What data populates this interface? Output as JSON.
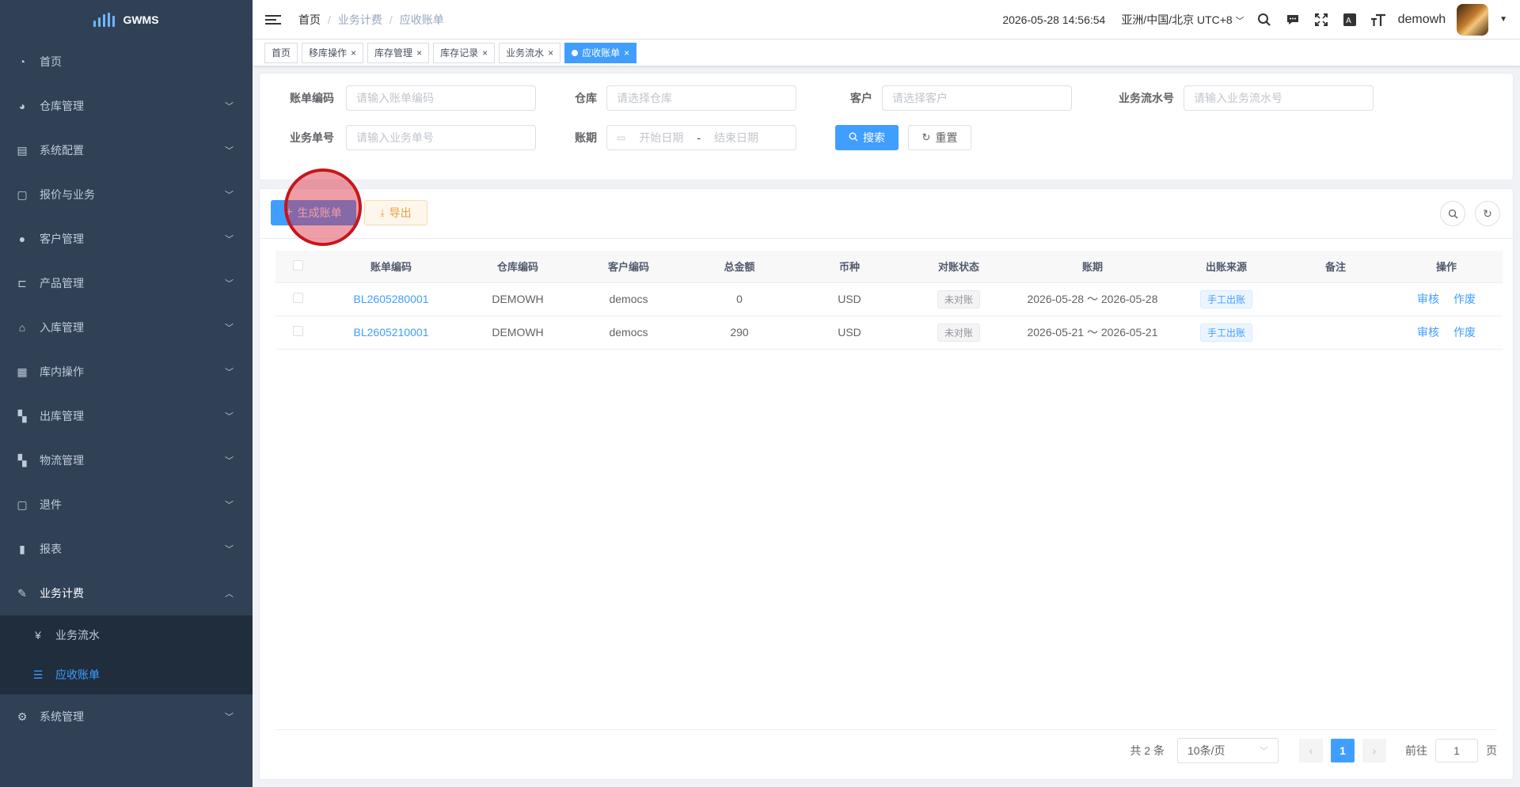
{
  "app": {
    "name": "GWMS"
  },
  "sidebar": {
    "items": [
      {
        "label": "首页",
        "icon": "dashboard-icon",
        "glyph": "◔"
      },
      {
        "label": "仓库管理",
        "icon": "globe-icon",
        "glyph": "◕"
      },
      {
        "label": "系统配置",
        "icon": "server-icon",
        "glyph": "▤"
      },
      {
        "label": "报价与业务",
        "icon": "document-icon",
        "glyph": "▢"
      },
      {
        "label": "客户管理",
        "icon": "user-icon",
        "glyph": "●"
      },
      {
        "label": "产品管理",
        "icon": "cart-icon",
        "glyph": "⊏"
      },
      {
        "label": "入库管理",
        "icon": "home-icon",
        "glyph": "⌂"
      },
      {
        "label": "库内操作",
        "icon": "table-icon",
        "glyph": "▦"
      },
      {
        "label": "出库管理",
        "icon": "grid-icon",
        "glyph": "▚"
      },
      {
        "label": "物流管理",
        "icon": "grid-icon",
        "glyph": "▚"
      },
      {
        "label": "退件",
        "icon": "document-icon",
        "glyph": "▢"
      },
      {
        "label": "报表",
        "icon": "bar-chart-icon",
        "glyph": "▮"
      },
      {
        "label": "业务计费",
        "icon": "edit-icon",
        "glyph": "✎"
      }
    ],
    "sub_items": [
      {
        "label": "业务流水",
        "icon": "yen-icon",
        "glyph": "¥"
      },
      {
        "label": "应收账单",
        "icon": "list-icon",
        "glyph": "☰"
      }
    ],
    "last_item": {
      "label": "系统管理",
      "icon": "gear-icon",
      "glyph": "⚙"
    }
  },
  "header": {
    "breadcrumb": [
      "首页",
      "业务计费",
      "应收账单"
    ],
    "datetime": "2026-05-28 14:56:54",
    "timezone": "亚洲/中国/北京 UTC+8",
    "username": "demowh"
  },
  "tags": [
    {
      "label": "首页",
      "closable": false
    },
    {
      "label": "移库操作",
      "closable": true
    },
    {
      "label": "库存管理",
      "closable": true
    },
    {
      "label": "库存记录",
      "closable": true
    },
    {
      "label": "业务流水",
      "closable": true
    },
    {
      "label": "应收账单",
      "closable": true,
      "active": true
    }
  ],
  "search": {
    "bill_code_label": "账单编码",
    "bill_code_placeholder": "请输入账单编码",
    "warehouse_label": "仓库",
    "warehouse_placeholder": "请选择仓库",
    "customer_label": "客户",
    "customer_placeholder": "请选择客户",
    "flow_label": "业务流水号",
    "flow_placeholder": "请输入业务流水号",
    "order_label": "业务单号",
    "order_placeholder": "请输入业务单号",
    "period_label": "账期",
    "start_placeholder": "开始日期",
    "range_sep": "-",
    "end_placeholder": "结束日期",
    "search_button": "搜索",
    "reset_button": "重置"
  },
  "toolbar": {
    "generate_button": "生成账单",
    "export_button": "导出"
  },
  "table": {
    "columns": [
      "账单编码",
      "仓库编码",
      "客户编码",
      "总金额",
      "币种",
      "对账状态",
      "账期",
      "出账来源",
      "备注",
      "操作"
    ],
    "rows": [
      {
        "code": "BL2605280001",
        "warehouse": "DEMOWH",
        "customer": "democs",
        "amount": "0",
        "currency": "USD",
        "status": "未对账",
        "period": "2026-05-28 ～ 2026-05-28",
        "source": "手工出账",
        "remark": "",
        "op1": "审核",
        "op2": "作废"
      },
      {
        "code": "BL2605210001",
        "warehouse": "DEMOWH",
        "customer": "democs",
        "amount": "290",
        "currency": "USD",
        "status": "未对账",
        "period": "2026-05-21 ～ 2026-05-21",
        "source": "手工出账",
        "remark": "",
        "op1": "审核",
        "op2": "作废"
      }
    ]
  },
  "pagination": {
    "total": "共 2 条",
    "page_size": "10条/页",
    "current_page": "1",
    "goto_label": "前往",
    "goto_value": "1",
    "page_suffix": "页"
  }
}
